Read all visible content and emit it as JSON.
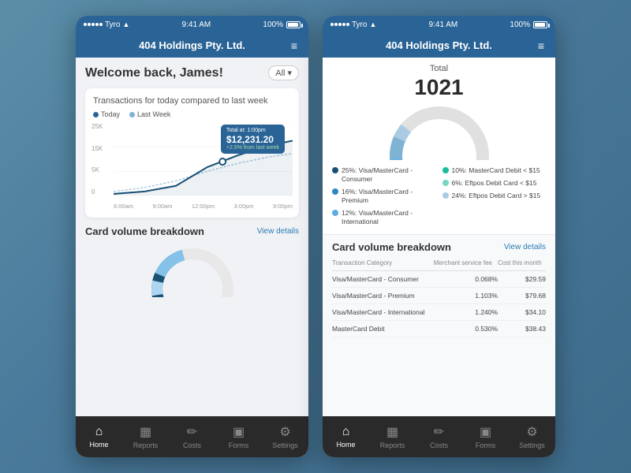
{
  "statusBar": {
    "carrier": "Tyro",
    "time": "9:41 AM",
    "battery": "100%"
  },
  "header": {
    "title": "404 Holdings Pty. Ltd.",
    "menuLabel": "≡"
  },
  "phone1": {
    "welcome": "Welcome back, James!",
    "allFilter": "All",
    "chartCard": {
      "title": "Transactions for today\ncompared to last week",
      "legend": {
        "todayLabel": "Today",
        "lastWeekLabel": "Last Week"
      },
      "yLabels": [
        "25K",
        "15K",
        "5K",
        "0"
      ],
      "xLabels": [
        "6:00am",
        "9:00am",
        "12:00pm",
        "3:00pm",
        "9:00pm"
      ],
      "tooltip": {
        "title": "Total at: 1:00pm",
        "amount": "$12,231.20",
        "change": "+2.5% from last week"
      }
    },
    "cardVolume": {
      "title": "Card volume breakdown",
      "viewDetails": "View details"
    }
  },
  "phone2": {
    "donut": {
      "totalLabel": "Total",
      "totalNumber": "1021",
      "legend": [
        {
          "label": "25%: Visa/MasterCard - Consumer",
          "color": "#1a5276"
        },
        {
          "label": "16%: Visa/MasterCard - Premium",
          "color": "#2e86c1"
        },
        {
          "label": "12%: Visa/MasterCard - International",
          "color": "#5dade2"
        }
      ],
      "legendRight": [
        {
          "label": "10%: MasterCard Debit < $15",
          "color": "#1abc9c"
        },
        {
          "label": "6%: Eftpos Debit Card < $15",
          "color": "#76d7c4"
        },
        {
          "label": "24%: Eftpos Debit Card > $15",
          "color": "#a9cce3"
        }
      ]
    },
    "breakdown": {
      "title": "Card volume breakdown",
      "viewDetails": "View details",
      "tableHeaders": [
        "Transaction Category",
        "Merchant service fee",
        "Cost this month"
      ],
      "rows": [
        {
          "category": "Visa/MasterCard - Consumer",
          "fee": "0.068%",
          "cost": "$29.59"
        },
        {
          "category": "Visa/MasterCard - Premium",
          "fee": "1.103%",
          "cost": "$79.68"
        },
        {
          "category": "Visa/MasterCard - International",
          "fee": "1.240%",
          "cost": "$34.10"
        },
        {
          "category": "MasterCard Debit",
          "fee": "0.530%",
          "cost": "$38.43"
        }
      ]
    }
  },
  "bottomNav": {
    "items": [
      {
        "id": "home",
        "icon": "⌂",
        "label": "Home",
        "active": true
      },
      {
        "id": "reports",
        "icon": "▦",
        "label": "Reports",
        "active": false
      },
      {
        "id": "costs",
        "icon": "✏",
        "label": "Costs",
        "active": false
      },
      {
        "id": "forms",
        "icon": "▣",
        "label": "Forms",
        "active": false
      },
      {
        "id": "settings",
        "icon": "⚙",
        "label": "Settings",
        "active": false
      }
    ]
  }
}
